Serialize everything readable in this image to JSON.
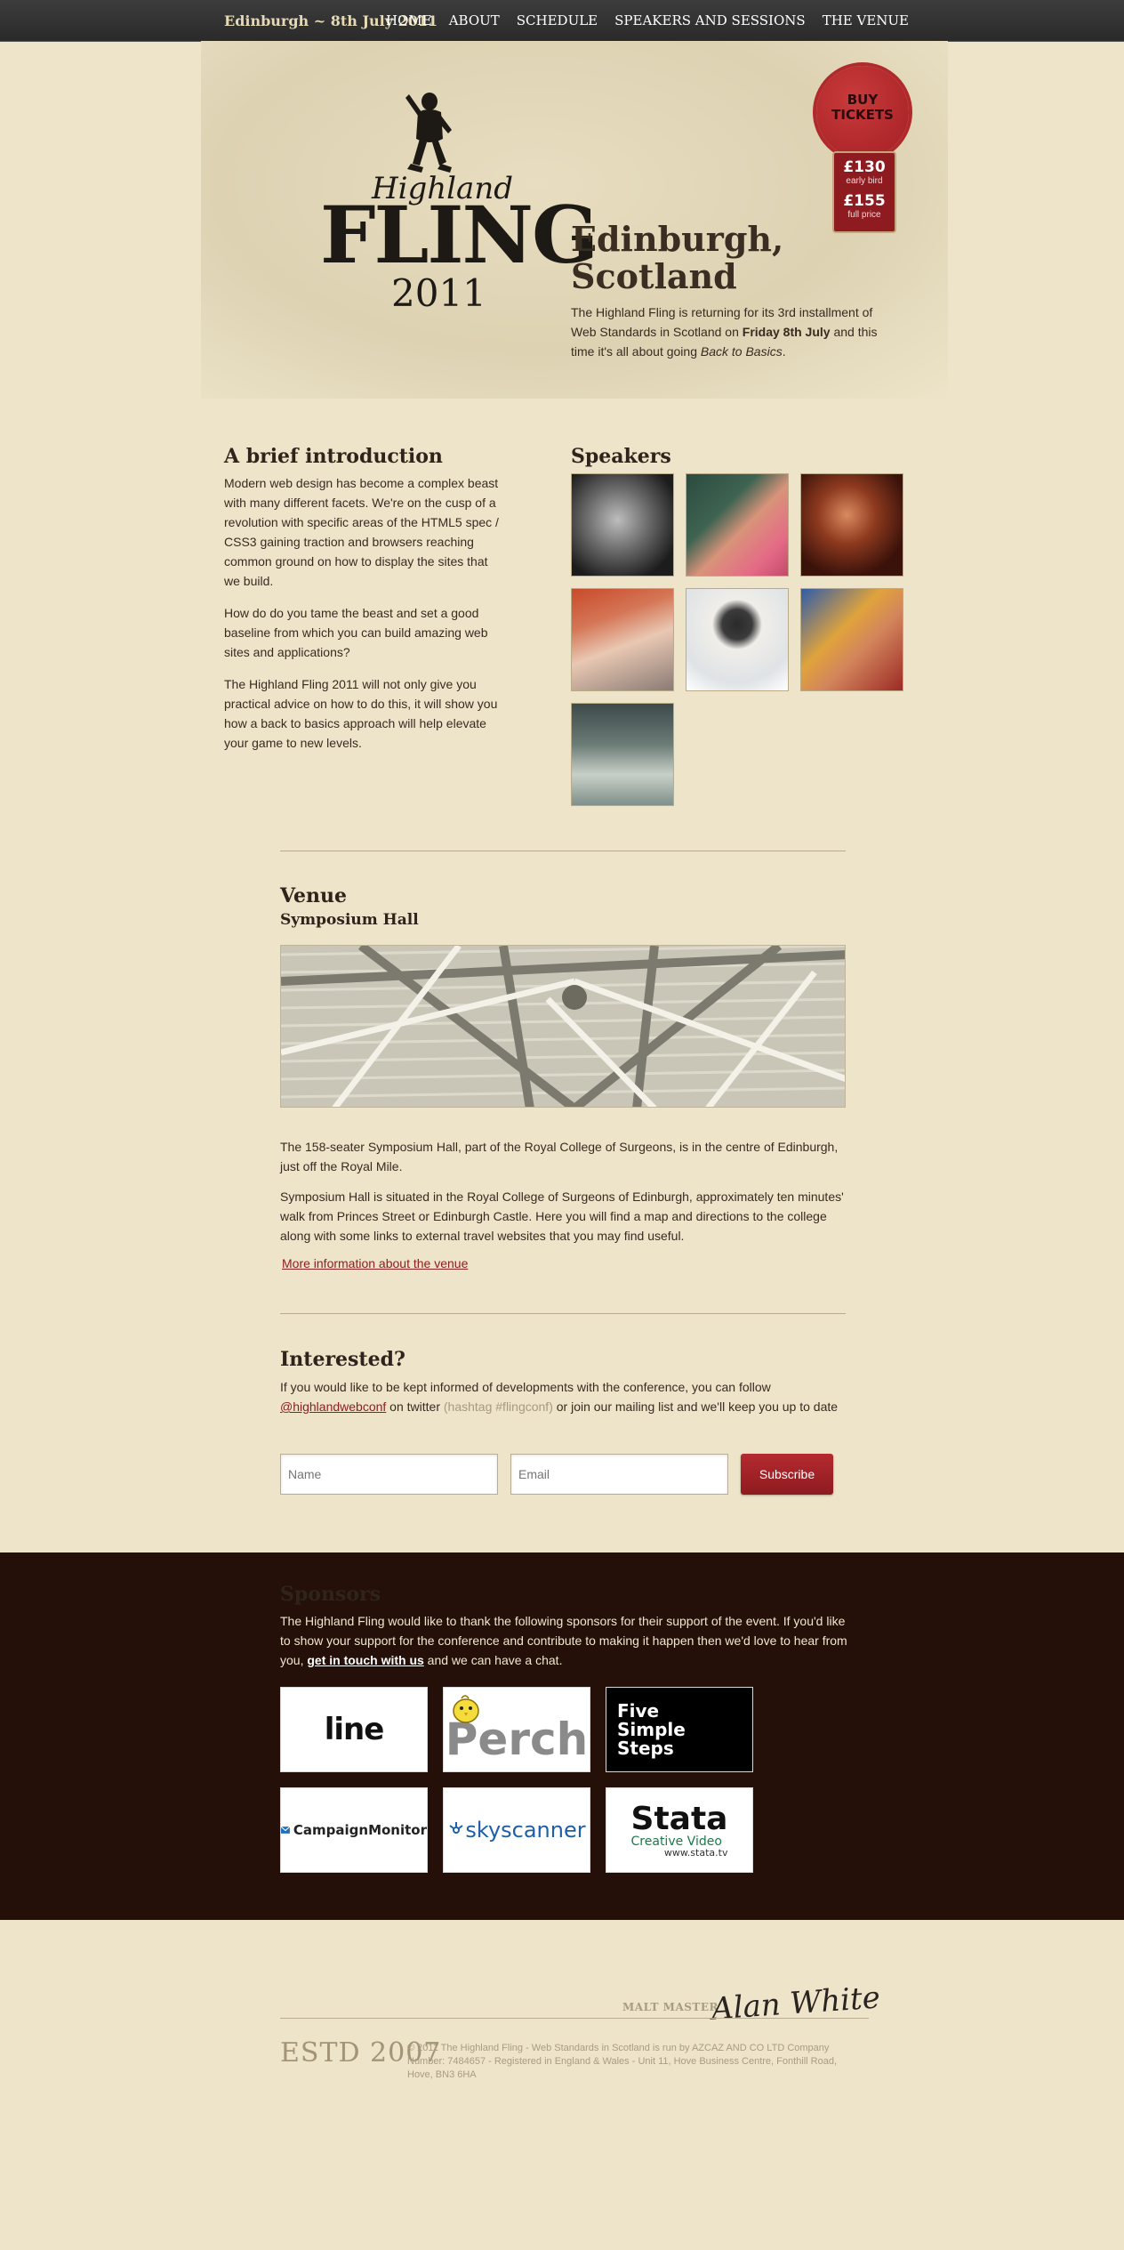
{
  "header": {
    "date_label": "Edinburgh ~ 8th July 2011",
    "nav": [
      "HOME",
      "ABOUT",
      "SCHEDULE",
      "SPEAKERS AND SESSIONS",
      "THE VENUE"
    ]
  },
  "hero": {
    "logo_highland": "Highland",
    "logo_fling": "FLING",
    "logo_year": "2011",
    "title": "Edinburgh, Scotland",
    "text_before": "The Highland Fling is returning for its 3rd installment of Web Standards in Scotland on ",
    "text_bold": "Friday 8th July",
    "text_middle": " and this time it's all about going ",
    "text_italic": "Back to Basics",
    "text_end": "."
  },
  "badge": {
    "label_line1": "BUY",
    "label_line2": "TICKETS",
    "price1": "£130",
    "price1_label": "early bird",
    "price2": "£155",
    "price2_label": "full price",
    "color": "#a31f24"
  },
  "intro": {
    "title": "A brief introduction",
    "paragraphs": [
      "Modern web design has become a complex beast with many different facets. We're on the cusp of a revolution with specific areas of the HTML5 spec / CSS3 gaining traction and browsers reaching common ground on how to display the sites that we build.",
      "How do do you tame the beast and set a good baseline from which you can build amazing web sites and applications?",
      "The Highland Fling 2011 will not only give you practical advice on how to do this, it will show you how a back to basics approach will help elevate your game to new levels."
    ]
  },
  "speakers": {
    "title": "Speakers",
    "count": 7
  },
  "venue": {
    "title": "Venue",
    "subtitle": "Symposium Hall",
    "paragraphs": [
      "The 158-seater Symposium Hall, part of the Royal College of Surgeons, is in the centre of Edinburgh, just off the Royal Mile.",
      "Symposium Hall is situated in the Royal College of Surgeons of Edinburgh, approximately ten minutes' walk from Princes Street or Edinburgh Castle. Here you will find a map and directions to the college along with some links to external travel websites that you may find useful."
    ],
    "link": "More information about the venue"
  },
  "interested": {
    "title": "Interested?",
    "text_before": "If you would like to be kept informed of developments with the conference, you can follow ",
    "twitter": "@highlandwebconf",
    "text_middle": " on twitter ",
    "hashtag": "(hashtag #flingconf)",
    "text_end": " or join our mailing list and we'll keep you up to date",
    "name_placeholder": "Name",
    "email_placeholder": "Email",
    "subscribe_label": "Subscribe"
  },
  "sponsors": {
    "title": "Sponsors",
    "text_before": "The Highland Fling would like to thank the following sponsors for their support of the event. If you'd like to show your support for the conference and contribute to making it happen then we'd love to hear from you, ",
    "touch_link": "get in touch with us",
    "text_end": " and we can have a chat.",
    "logos": {
      "line": "line",
      "perch": "Perch",
      "five": "Five\nSimple\nSteps",
      "campaign": "CampaignMonitor",
      "skyscanner": "skyscanner",
      "stata": "Stata",
      "stata_sub": "Creative Video",
      "stata_url": "www.stata.tv"
    }
  },
  "footer": {
    "malt_master": "MALT MASTER",
    "signature": "Alan White",
    "estd": "ESTD 2007",
    "text": "© 2011 The Highland Fling - Web Standards in Scotland is run by AZCAZ AND CO LTD Company Number: 7484657 - Registered in England & Wales - Unit 11, Hove Business Centre, Fonthill Road, Hove, BN3 6HA"
  }
}
